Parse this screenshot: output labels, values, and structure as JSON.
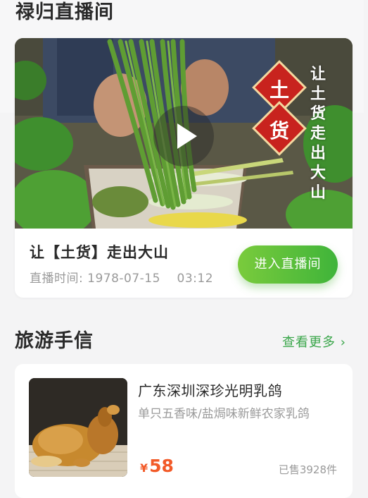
{
  "live_section": {
    "title": "禄归直播间",
    "video": {
      "badge_top": "土",
      "badge_bottom": "货",
      "slogan": "让土货走出大山"
    },
    "card_title": "让【土货】走出大山",
    "time_label": "直播时间:",
    "time_value": "1978-07-15    03:12",
    "enter_button": "进入直播间"
  },
  "travel_section": {
    "title": "旅游手信",
    "more_link": "查看更多 ›",
    "products": [
      {
        "name": "广东深圳深珍光明乳鸽",
        "description": "单只五香味/盐焗味新鲜农家乳鸽",
        "currency": "¥",
        "price": "58",
        "sold": "已售3928件"
      }
    ]
  },
  "colors": {
    "accent_green": "#3fb43a",
    "price_orange": "#f25a28",
    "badge_red": "#c8231e"
  },
  "icons": [
    "play-icon"
  ]
}
